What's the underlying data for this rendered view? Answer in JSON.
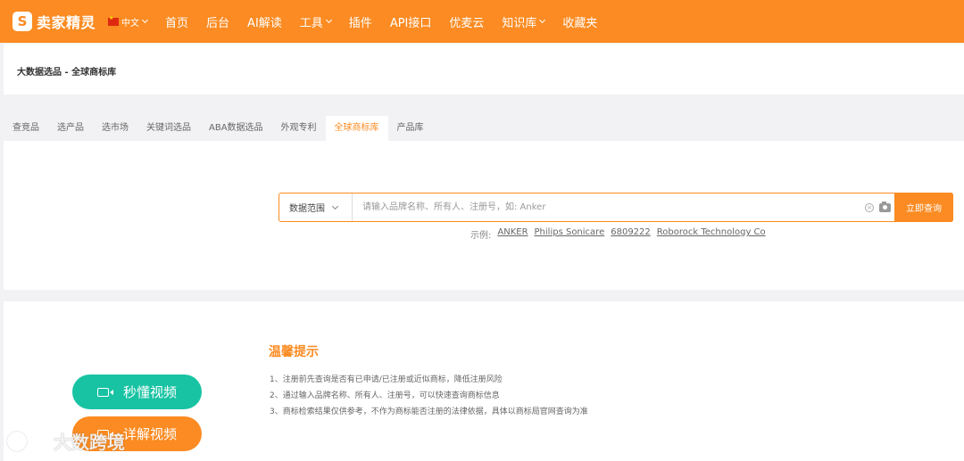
{
  "brand": {
    "logo_glyph": "S",
    "name": "卖家精灵"
  },
  "lang": {
    "label": "中文"
  },
  "nav": [
    {
      "label": "首页",
      "has_dropdown": false
    },
    {
      "label": "后台",
      "has_dropdown": false
    },
    {
      "label": "AI解读",
      "has_dropdown": false
    },
    {
      "label": "工具",
      "has_dropdown": true
    },
    {
      "label": "插件",
      "has_dropdown": false
    },
    {
      "label": "API接口",
      "has_dropdown": false
    },
    {
      "label": "优麦云",
      "has_dropdown": false
    },
    {
      "label": "知识库",
      "has_dropdown": true
    },
    {
      "label": "收藏夹",
      "has_dropdown": false
    }
  ],
  "breadcrumb": "大数据选品 - 全球商标库",
  "tabs": [
    {
      "label": "查竞品",
      "active": false
    },
    {
      "label": "选产品",
      "active": false
    },
    {
      "label": "选市场",
      "active": false
    },
    {
      "label": "关键词选品",
      "active": false
    },
    {
      "label": "ABA数据选品",
      "active": false
    },
    {
      "label": "外观专利",
      "active": false
    },
    {
      "label": "全球商标库",
      "active": true
    },
    {
      "label": "产品库",
      "active": false
    }
  ],
  "search": {
    "scope_label": "数据范围",
    "placeholder": "请输入品牌名称、所有人、注册号，如: Anker",
    "value": "",
    "button_label": "立即查询"
  },
  "examples": {
    "label": "示例:",
    "items": [
      "ANKER",
      "Philips Sonicare",
      "6809222",
      "Roborock Technology Co"
    ]
  },
  "tips": {
    "title": "温馨提示",
    "lines": [
      "1、注册前先查询是否有已申请/已注册或近似商标，降低注册风险",
      "2、通过输入品牌名称、所有人、注册号，可以快速查询商标信息",
      "3、商标检索结果仅供参考，不作为商标能否注册的法律依据，具体以商标局官网查询为准"
    ]
  },
  "video_buttons": {
    "quick": "秒懂视频",
    "detail": "详解视频"
  },
  "watermark": "大数跨境",
  "colors": {
    "brand_orange": "#fb8b22",
    "teal": "#18c3a3"
  }
}
